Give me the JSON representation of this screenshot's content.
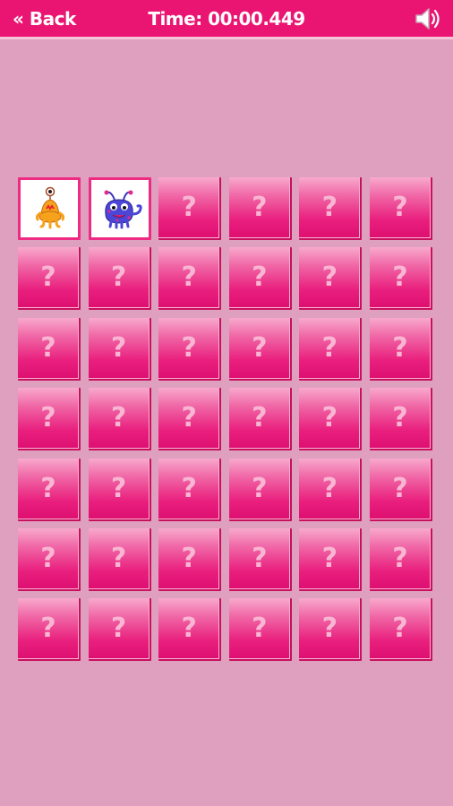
{
  "header": {
    "back_label": "« Back",
    "timer_label": "Time: 00:00.449",
    "sound_icon": "speaker-icon"
  },
  "board": {
    "rows": 7,
    "columns": 6,
    "hidden_symbol": "?",
    "revealed": [
      {
        "row": 1,
        "col": 1,
        "icon": "orange-one-eyed-monster-icon"
      },
      {
        "row": 1,
        "col": 2,
        "icon": "blue-antenna-monster-icon"
      }
    ]
  },
  "colors": {
    "header": "#ea1572",
    "background": "#df9fbe",
    "card": "#ec2c83",
    "question_mark": "#f9b6d3"
  }
}
